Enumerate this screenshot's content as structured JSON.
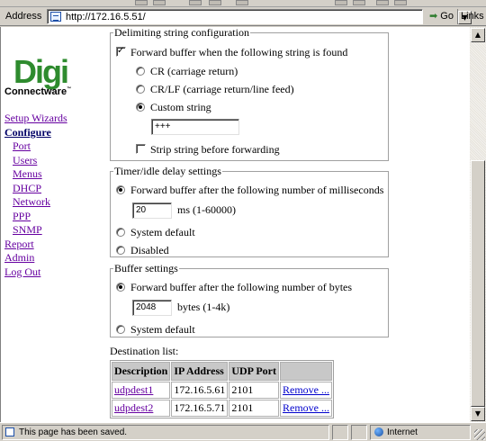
{
  "browser": {
    "address_label": "Address",
    "url": "http://172.16.5.51/",
    "go_label": "Go",
    "links_label": "Links",
    "status_text": "This page has been saved.",
    "zone_text": "Internet"
  },
  "brand": {
    "logo_text": "Digi",
    "name": "Connectware",
    "trademark": "™"
  },
  "nav": {
    "setup_wizards": "Setup Wizards",
    "configure": "Configure",
    "port": "Port",
    "users": "Users",
    "menus": "Menus",
    "dhcp": "DHCP",
    "network": "Network",
    "ppp": "PPP",
    "snmp": "SNMP",
    "report": "Report",
    "admin": "Admin",
    "logout": "Log Out"
  },
  "delimiting": {
    "legend": "Delimiting string configuration",
    "forward_label": "Forward buffer when the following string is found",
    "cr_label": "CR (carriage return)",
    "crlf_label": "CR/LF (carriage return/line feed)",
    "custom_label": "Custom string",
    "custom_value": "+++",
    "strip_label": "Strip string before forwarding"
  },
  "timer": {
    "legend": "Timer/idle delay settings",
    "forward_label": "Forward buffer after the following number of milliseconds",
    "ms_value": "20",
    "ms_unit": "ms (1-60000)",
    "system_default_label": "System default",
    "disabled_label": "Disabled"
  },
  "buffer": {
    "legend": "Buffer settings",
    "forward_label": "Forward buffer after the following number of bytes",
    "bytes_value": "2048",
    "bytes_unit": "bytes (1-4k)",
    "system_default_label": "System default"
  },
  "destinations": {
    "label": "Destination list:",
    "headers": [
      "Description",
      "IP Address",
      "UDP Port"
    ],
    "rows": [
      {
        "description": "udpdest1",
        "ip": "172.16.5.61",
        "port": "2101",
        "action": "Remove ..."
      },
      {
        "description": "udpdest2",
        "ip": "172.16.5.71",
        "port": "2101",
        "action": "Remove ..."
      }
    ]
  },
  "colors": {
    "link": "#6600a0",
    "logo_green": "#2e8b2e",
    "active_nav": "#000066"
  }
}
